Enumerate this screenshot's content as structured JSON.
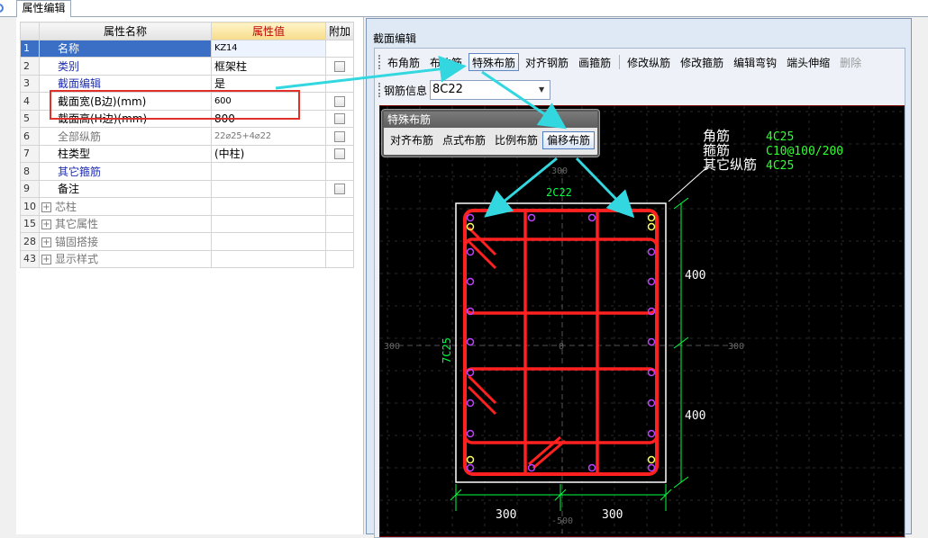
{
  "tab": {
    "label": "属性编辑"
  },
  "property_table": {
    "headers": {
      "index": "",
      "name": "属性名称",
      "value": "属性值",
      "extra": "附加"
    },
    "rows": [
      {
        "index": "1",
        "name": "名称",
        "value": "KZ14",
        "name_style": "blue",
        "value_size": "small",
        "checkbox": false,
        "selected": true
      },
      {
        "index": "2",
        "name": "类别",
        "value": "框架柱",
        "name_style": "blue",
        "checkbox": true
      },
      {
        "index": "3",
        "name": "截面编辑",
        "value": "是",
        "name_style": "blue",
        "checkbox": false
      },
      {
        "index": "4",
        "name": "截面宽(B边)(mm)",
        "value": "600",
        "name_style": "normal",
        "value_size": "small",
        "checkbox": true
      },
      {
        "index": "5",
        "name": "截面高(H边)(mm)",
        "value": "800",
        "name_style": "normal",
        "checkbox": true
      },
      {
        "index": "6",
        "name": "全部纵筋",
        "value": "22⌀25+4⌀22",
        "name_style": "gray",
        "value_size": "small",
        "value_style": "gray",
        "checkbox": true
      },
      {
        "index": "7",
        "name": "柱类型",
        "value": "(中柱)",
        "name_style": "normal",
        "checkbox": true
      },
      {
        "index": "8",
        "name": "其它箍筋",
        "value": "",
        "name_style": "blue",
        "checkbox": false
      },
      {
        "index": "9",
        "name": "备注",
        "value": "",
        "name_style": "normal",
        "checkbox": true
      }
    ],
    "groups": [
      {
        "index": "10",
        "name": "芯柱"
      },
      {
        "index": "15",
        "name": "其它属性"
      },
      {
        "index": "28",
        "name": "锚固搭接"
      },
      {
        "index": "43",
        "name": "显示样式"
      }
    ]
  },
  "editor": {
    "title": "截面编辑",
    "toolbar": [
      "布角筋",
      "布边筋",
      "特殊布筋",
      "对齐钢筋",
      "画箍筋",
      "修改纵筋",
      "修改箍筋",
      "编辑弯钩",
      "端头伸缩",
      "删除"
    ],
    "active_tool": "特殊布筋",
    "disabled_tool": "删除",
    "rebar_info_label": "钢筋信息",
    "rebar_info_value": "8C22"
  },
  "popup": {
    "title": "特殊布筋",
    "buttons": [
      "对齐布筋",
      "点式布筋",
      "比例布筋",
      "偏移布筋"
    ],
    "active": "偏移布筋"
  },
  "drawing": {
    "legend": [
      {
        "label": "角筋",
        "value": "4C25"
      },
      {
        "label": "箍筋",
        "value": "C10@100/200"
      },
      {
        "label": "其它纵筋",
        "value": "4C25"
      }
    ],
    "top_rebar_label": "2C22",
    "side_rebar_label": "7C25",
    "dim_right_upper": "400",
    "dim_right_lower": "400",
    "dim_bottom_left": "300",
    "dim_bottom_right": "300",
    "axis_top": "300",
    "axis_left": "300",
    "axis_right": "300",
    "axis_center": "0",
    "axis_bottom": "-500",
    "colors": {
      "rebar": "#ff2020",
      "dim": "#00ff40",
      "text": "#ffffff",
      "legend_value": "#33ff33",
      "callout": "#33d7e0"
    }
  }
}
